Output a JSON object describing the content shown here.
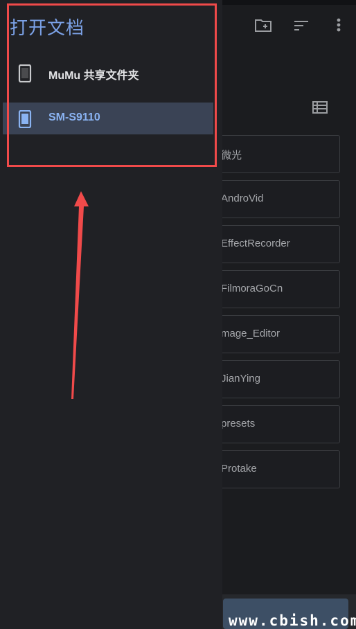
{
  "drawer": {
    "title": "打开文档",
    "roots": [
      {
        "label": "MuMu 共享文件夹",
        "icon": "phone-icon",
        "selected": false
      },
      {
        "label": "SM-S9110",
        "icon": "phone-icon",
        "selected": true
      }
    ]
  },
  "toolbar": {
    "icons": [
      "new-folder-icon",
      "sort-icon",
      "more-vert-icon"
    ]
  },
  "files": {
    "folders": [
      "微光",
      "AndroVid",
      "EffectRecorder",
      "FilmoraGoCn",
      "mage_Editor",
      "JianYing",
      "presets",
      "Protake"
    ]
  },
  "watermark": "www.cbish.com",
  "colors": {
    "accent": "#7ba1e6",
    "selected_bg": "#3a4355",
    "annotation": "#f04a4a",
    "drawer_bg": "#202125",
    "bg": "#1b1c1f"
  }
}
